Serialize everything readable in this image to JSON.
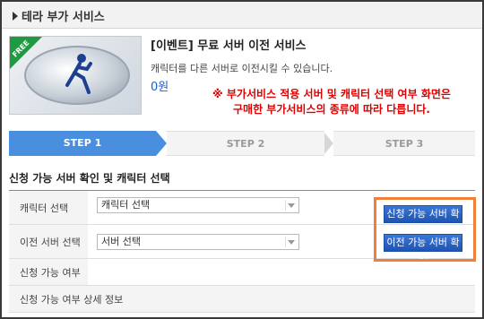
{
  "header": {
    "title": "테라 부가 서비스"
  },
  "product": {
    "badge": "FREE",
    "title": "[이벤트] 무료 서버 이전 서비스",
    "description": "캐릭터를 다른 서버로 이전시킬 수 있습니다.",
    "price": "0원"
  },
  "notice": {
    "line1": "※ 부가서비스 적용 서버 및 캐릭터 선택 여부 화면은",
    "line2": "구매한 부가서비스의 종류에 따라 다릅니다."
  },
  "steps": [
    {
      "label": "STEP 1",
      "active": true
    },
    {
      "label": "STEP 2",
      "active": false
    },
    {
      "label": "STEP 3",
      "active": false
    }
  ],
  "form": {
    "section_title": "신청 가능 서버 확인 및 캐릭터 선택",
    "rows": [
      {
        "label": "캐릭터 선택",
        "select_value": "캐릭터 선택",
        "button": "신청 가능 서버 확인"
      },
      {
        "label": "이전 서버 선택",
        "select_value": "서버 선택",
        "button": "이전 가능 서버 확인"
      },
      {
        "label": "신청 가능 여부"
      },
      {
        "label": "신청 가능 여부 상세 정보"
      }
    ]
  },
  "colors": {
    "step_active": "#4a8ee0",
    "notice": "#e00000",
    "button": "#1e54b5",
    "highlight": "#f07f3c",
    "price": "#1a5fd6"
  }
}
